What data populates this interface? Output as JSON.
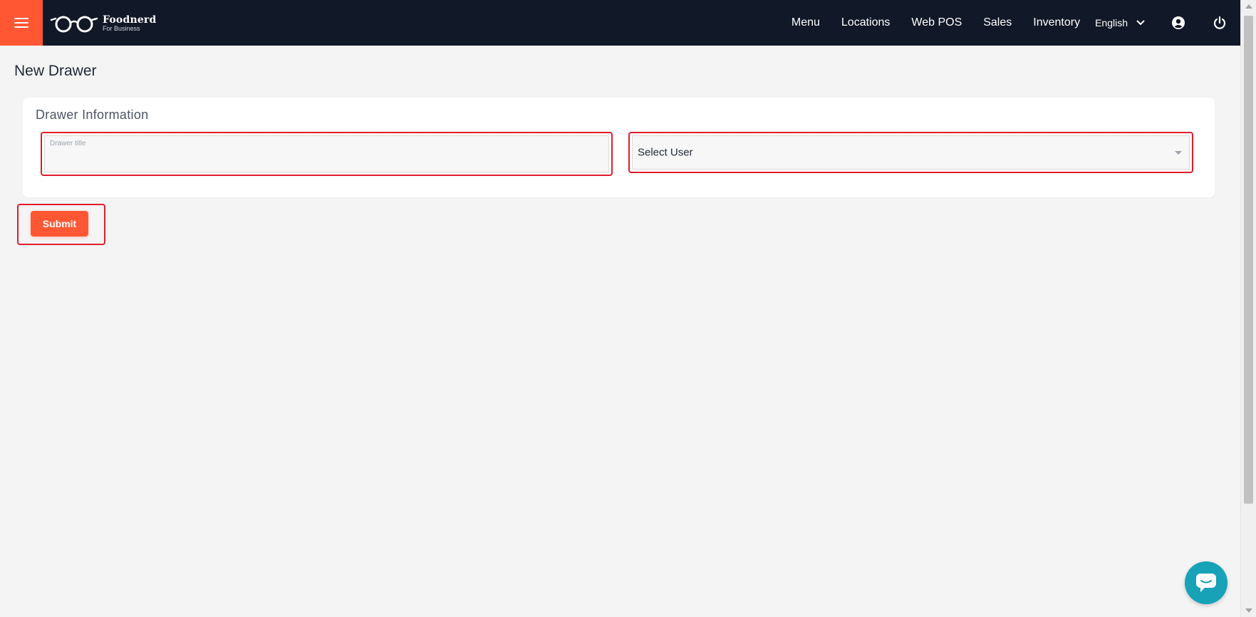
{
  "header": {
    "logo": {
      "name": "Foodnerd",
      "subtitle": "For Business"
    },
    "nav": [
      {
        "label": "Menu"
      },
      {
        "label": "Locations"
      },
      {
        "label": "Web POS"
      },
      {
        "label": "Sales"
      },
      {
        "label": "Inventory"
      }
    ],
    "language": "English",
    "icons": [
      "menu-icon",
      "user-circle-icon",
      "power-icon",
      "chevron-down-icon"
    ]
  },
  "page": {
    "title": "New Drawer"
  },
  "form": {
    "section_title": "Drawer Information",
    "drawer_title": {
      "label": "Drawer title",
      "value": ""
    },
    "user_select": {
      "value": "Select User"
    },
    "submit_label": "Submit"
  },
  "colors": {
    "accent": "#ff5733",
    "header_bg": "#111827",
    "highlight": "#e11d2a",
    "chat": "#17a2b8"
  }
}
